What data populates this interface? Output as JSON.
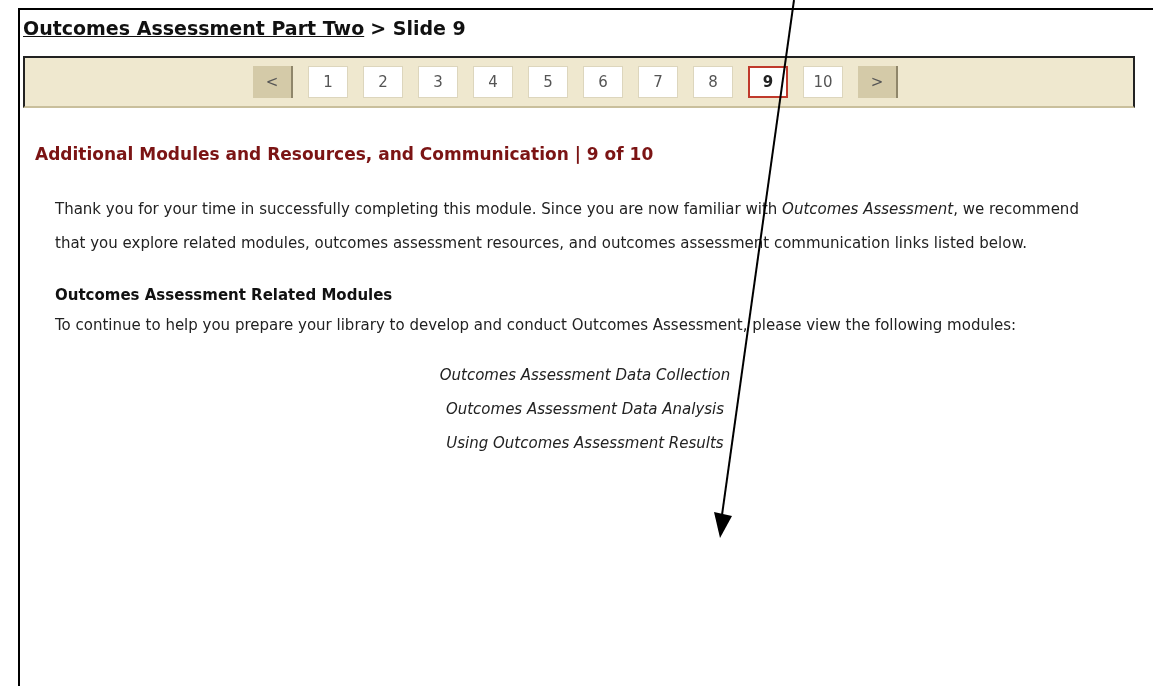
{
  "breadcrumb": {
    "link": "Outcomes Assessment Part Two",
    "current": "> Slide 9"
  },
  "pagination": {
    "prev": "<",
    "next": ">",
    "pages": [
      {
        "label": "1",
        "selected": false
      },
      {
        "label": "2",
        "selected": false
      },
      {
        "label": "3",
        "selected": false
      },
      {
        "label": "4",
        "selected": false
      },
      {
        "label": "5",
        "selected": false
      },
      {
        "label": "6",
        "selected": false
      },
      {
        "label": "7",
        "selected": false
      },
      {
        "label": "8",
        "selected": false
      },
      {
        "label": "9",
        "selected": true
      },
      {
        "label": "10",
        "selected": false
      }
    ]
  },
  "heading": "Additional Modules and Resources, and Communication | 9 of 10",
  "intro": "Thank you for your time in successfully completing this module. Since you are now familiar with *Outcomes Assessment*, we recommend that you explore related modules, outcomes assessment resources, and outcomes assessment communication links listed below.",
  "section": {
    "title": "Outcomes Assessment Related Modules",
    "text": "To continue to help you prepare your library to develop and conduct Outcomes Assessment, please view the following modules:",
    "modules": [
      "Outcomes Assessment Data Collection",
      "Outcomes Assessment Data Analysis",
      "Using Outcomes Assessment Results"
    ]
  }
}
